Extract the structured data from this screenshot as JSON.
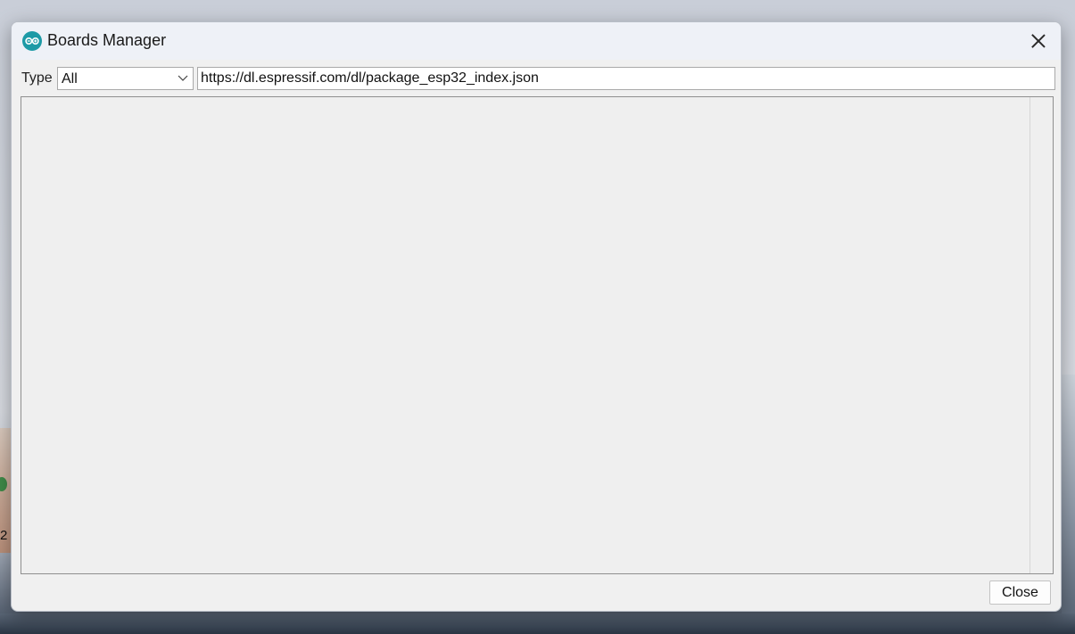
{
  "window": {
    "title": "Boards Manager",
    "accent_color": "#1d9aa6"
  },
  "toolbar": {
    "type_label": "Type",
    "type_selected": "All",
    "filter_value": "https://dl.espressif.com/dl/package_esp32_index.json"
  },
  "footer": {
    "close_label": "Close"
  },
  "desktop": {
    "visible_fragment_text": "2"
  },
  "icons": {
    "app": "arduino-logo-icon",
    "window_close": "close-icon",
    "select_arrow": "chevron-down-icon"
  }
}
